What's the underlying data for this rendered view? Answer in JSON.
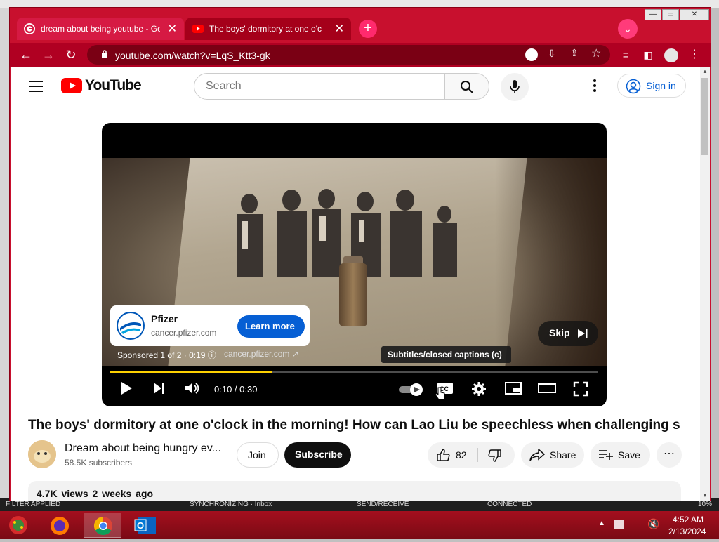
{
  "browser": {
    "tabs": [
      {
        "label": "dream about being youtube - Go",
        "icon": "google-icon"
      },
      {
        "label": "The boys' dormitory at one o'c",
        "icon": "youtube-icon"
      }
    ],
    "new_tab": "+",
    "url": "youtube.com/watch?v=LqS_Ktt3-gk",
    "accent": "#c8102e"
  },
  "youtube": {
    "logo": "YouTube",
    "search_placeholder": "Search",
    "sign_in": "Sign in"
  },
  "player": {
    "ad": {
      "advertiser": "Pfizer",
      "domain": "cancer.pfizer.com",
      "cta": "Learn more",
      "info": "Sponsored 1 of 2 · 0:19",
      "info_url": "cancer.pfizer.com"
    },
    "skip": "Skip",
    "tooltip": "Subtitles/closed captions (c)",
    "time": "0:10 / 0:30",
    "progress": 0.333,
    "progress_color": "#fcd001"
  },
  "video": {
    "title": "The boys' dormitory at one o'clock in the morning! How can Lao Liu be speechless when challenging s",
    "channel": "Dream about being hungry ev...",
    "subscribers": "58.5K subscribers",
    "join": "Join",
    "subscribe": "Subscribe",
    "likes": "82",
    "share": "Share",
    "save": "Save",
    "views": "4.7K views",
    "age": "2 weeks ago"
  },
  "outlook_status": {
    "filter": "FILTER APPLIED",
    "sync": "SYNCHRONIZING · Inbox",
    "sendrecv": "SEND/RECEIVE",
    "connected": "CONNECTED",
    "zoom": "10%"
  },
  "taskbar": {
    "time": "4:52 AM",
    "date": "2/13/2024"
  }
}
